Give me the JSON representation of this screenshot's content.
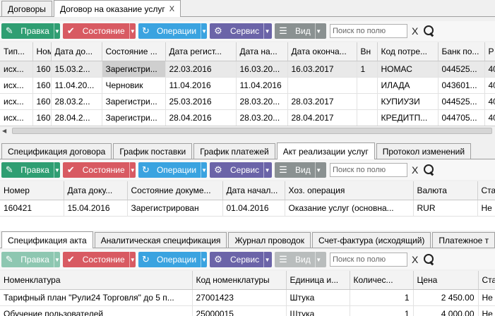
{
  "top_tabs": [
    {
      "label": "Договоры"
    },
    {
      "label": "Договор на оказание услуг",
      "close": "X"
    }
  ],
  "toolbar": {
    "edit": "Правка",
    "state": "Состояние",
    "ops": "Операции",
    "service": "Сервис",
    "view": "Вид",
    "search_placeholder": "Поиск по полю",
    "clear": "X"
  },
  "contracts": {
    "headers": [
      "Тип...",
      "Ном",
      "Дата до...",
      "Состояние ...",
      "Дата регист...",
      "Дата на...",
      "Дата оконча...",
      "Вн",
      "Код потре...",
      "Банк по...",
      "Р"
    ],
    "rows": [
      [
        "исх...",
        "160",
        "15.03.2...",
        "Зарегистри...",
        "22.03.2016",
        "16.03.20...",
        "16.03.2017",
        "1",
        "НОМАС",
        "044525...",
        "40"
      ],
      [
        "исх...",
        "160",
        "11.04.20...",
        "Черновик",
        "11.04.2016",
        "11.04.2016",
        "",
        "",
        "ИЛАДА",
        "043601...",
        "40"
      ],
      [
        "исх...",
        "160",
        "28.03.2...",
        "Зарегистри...",
        "25.03.2016",
        "28.03.20...",
        "28.03.2017",
        "",
        "КУПИУЗИ",
        "044525...",
        "40"
      ],
      [
        "исх...",
        "160",
        "28.04.2...",
        "Зарегистри...",
        "28.04.2016",
        "28.03.20...",
        "28.04.2017",
        "",
        "КРЕДИТП...",
        "044705...",
        "40"
      ]
    ]
  },
  "mid_tabs": [
    "Спецификация договора",
    "График поставки",
    "График платежей",
    "Акт реализации услуг",
    "Протокол изменений"
  ],
  "acts": {
    "headers": [
      "Номер",
      "Дата доку...",
      "Состояние докуме...",
      "Дата начал...",
      "Хоз. операция",
      "Валюта",
      "Ста"
    ],
    "rows": [
      [
        "160421",
        "15.04.2016",
        "Зарегистрирован",
        "01.04.2016",
        "Оказание услуг (основна...",
        "RUR",
        "Не"
      ]
    ]
  },
  "bottom_tabs": [
    "Спецификация акта",
    "Аналитическая спецификация",
    "Журнал проводок",
    "Счет-фактура (исходящий)",
    "Платежное т"
  ],
  "spec": {
    "headers": [
      "Номенклатура",
      "Код номенклатуры",
      "Единица и...",
      "Количес...",
      "Цена",
      "Ста"
    ],
    "rows": [
      [
        "Тарифный план \"Рули24 Торговля\" до 5 п...",
        "27001423",
        "Штука",
        "1",
        "2 450.00",
        "Не"
      ],
      [
        "Обучение пользователей",
        "25000015",
        "Штука",
        "1",
        "4 000.00",
        "Не"
      ]
    ]
  },
  "colors": {
    "edit": "#2f9e72",
    "state": "#d85a62",
    "ops": "#3aa3e0",
    "service": "#6b64a8",
    "view": "#8a9191"
  }
}
